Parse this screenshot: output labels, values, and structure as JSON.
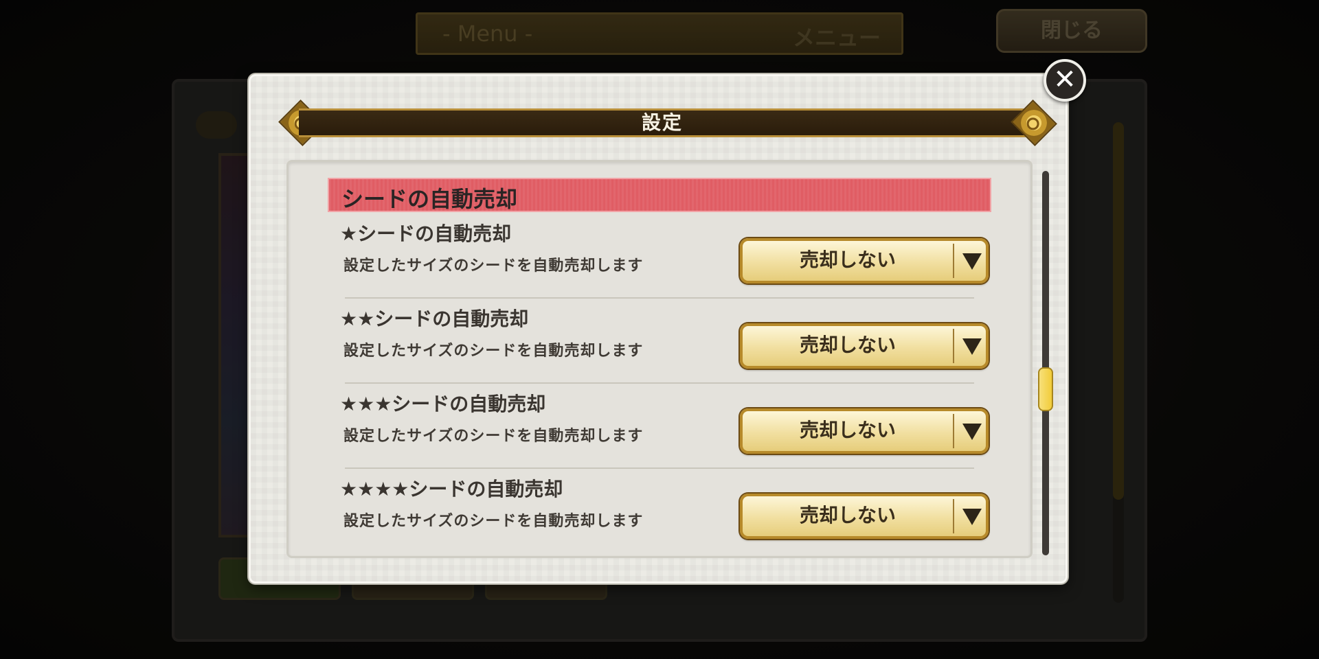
{
  "background": {
    "menu_bar": {
      "en": "- Menu -",
      "jp": "メニュー"
    },
    "close_label": "閉じる"
  },
  "dialog": {
    "title": "設定",
    "close_icon": "✕",
    "section_header": "シードの自動売却",
    "rows": [
      {
        "title": "★シードの自動売却",
        "description": "設定したサイズのシードを自動売却します",
        "value": "売却しない"
      },
      {
        "title": "★★シードの自動売却",
        "description": "設定したサイズのシードを自動売却します",
        "value": "売却しない"
      },
      {
        "title": "★★★シードの自動売却",
        "description": "設定したサイズのシードを自動売却します",
        "value": "売却しない"
      },
      {
        "title": "★★★★シードの自動売却",
        "description": "設定したサイズのシードを自動売却します",
        "value": "売却しない"
      }
    ],
    "scroll_position": 0.55
  },
  "colors": {
    "section_header": "#e05d64",
    "banner": "#2a1c0b",
    "dropdown_gold": "#f1dfa0",
    "scroll_thumb": "#f2cc3a"
  }
}
